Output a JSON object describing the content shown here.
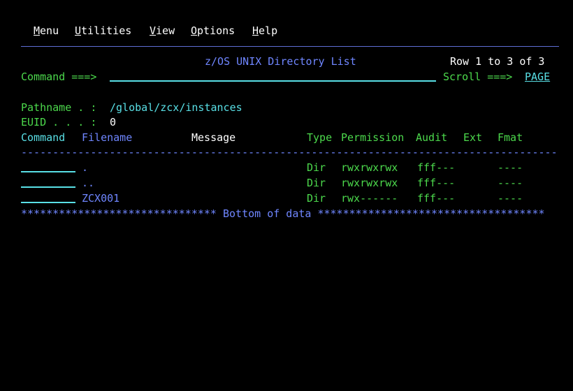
{
  "menu": [
    {
      "hot": "M",
      "rest": "enu"
    },
    {
      "hot": "U",
      "rest": "tilities"
    },
    {
      "hot": "V",
      "rest": "iew"
    },
    {
      "hot": "O",
      "rest": "ptions"
    },
    {
      "hot": "H",
      "rest": "elp"
    }
  ],
  "panel": {
    "title": "z/OS UNIX Directory List",
    "row_info": "Row 1 to 3 of 3",
    "command_label": "Command ===>",
    "command_value": "",
    "scroll_label": "Scroll ===>",
    "scroll_value": "PAGE",
    "pathname_label": "Pathname . :",
    "pathname_value": "/global/zcx/instances",
    "euid_label": "EUID . . . :",
    "euid_value": "0"
  },
  "columns": {
    "command": "Command",
    "filename": "Filename",
    "message": "Message",
    "type": "Type",
    "permission": "Permission",
    "audit": "Audit",
    "ext": "Ext",
    "fmat": "Fmat"
  },
  "rows": [
    {
      "filename": ".",
      "type": "Dir",
      "permission": "rwxrwxrwx",
      "audit": "fff---",
      "fmat": "----"
    },
    {
      "filename": "..",
      "type": "Dir",
      "permission": "rwxrwxrwx",
      "audit": "fff---",
      "fmat": "----"
    },
    {
      "filename": "ZCX001",
      "type": "Dir",
      "permission": "rwx------",
      "audit": "fff---",
      "fmat": "----"
    }
  ],
  "bottom_text": "Bottom of data",
  "colors": {
    "background": "#000000",
    "input_fields": "#59e0e6",
    "output_data": "#4cd94c",
    "headers": "#6f86ff",
    "menu": "#ffffff"
  }
}
